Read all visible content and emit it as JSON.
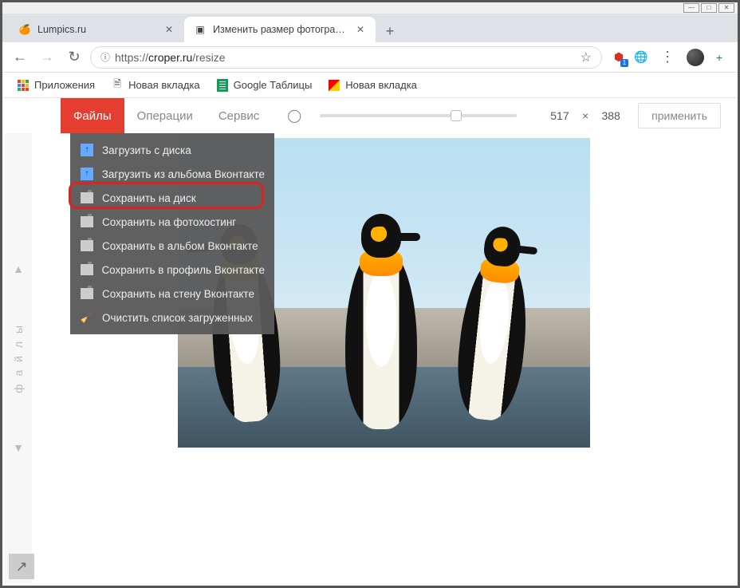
{
  "window": {
    "min": "—",
    "max": "□",
    "close": "✕"
  },
  "tabs": {
    "items": [
      {
        "title": "Lumpics.ru",
        "favicon": "🍊"
      },
      {
        "title": "Изменить размер фотографии",
        "favicon": "▣"
      }
    ],
    "new_tab": "+"
  },
  "nav": {
    "back": "←",
    "forward": "→",
    "reload": "↻",
    "secure": "ⓘ",
    "proto": "https://",
    "host": "croper.ru",
    "path": "/resize",
    "star": "☆"
  },
  "ext": {
    "globe": "🌐",
    "plus": "+"
  },
  "bookmarks": {
    "apps": "Приложения",
    "items": [
      {
        "label": "Новая вкладка",
        "icon": "doc"
      },
      {
        "label": "Google Таблицы",
        "icon": "sheets"
      },
      {
        "label": "Новая вкладка",
        "icon": "y"
      }
    ]
  },
  "toolbar": {
    "tabs": {
      "files": "Файлы",
      "ops": "Операции",
      "service": "Сервис"
    },
    "width": "517",
    "times": "×",
    "height": "388",
    "apply": "применить"
  },
  "rail": {
    "label": "ф а й л ы",
    "up": "▲",
    "down": "▼"
  },
  "menu": {
    "items": [
      "Загрузить с диска",
      "Загрузить из альбома Вконтакте",
      "Сохранить на диск",
      "Сохранить на фотохостинг",
      "Сохранить в альбом Вконтакте",
      "Сохранить в профиль Вконтакте",
      "Сохранить на стену Вконтакте",
      "Очистить список загруженных"
    ]
  },
  "share": "↗"
}
